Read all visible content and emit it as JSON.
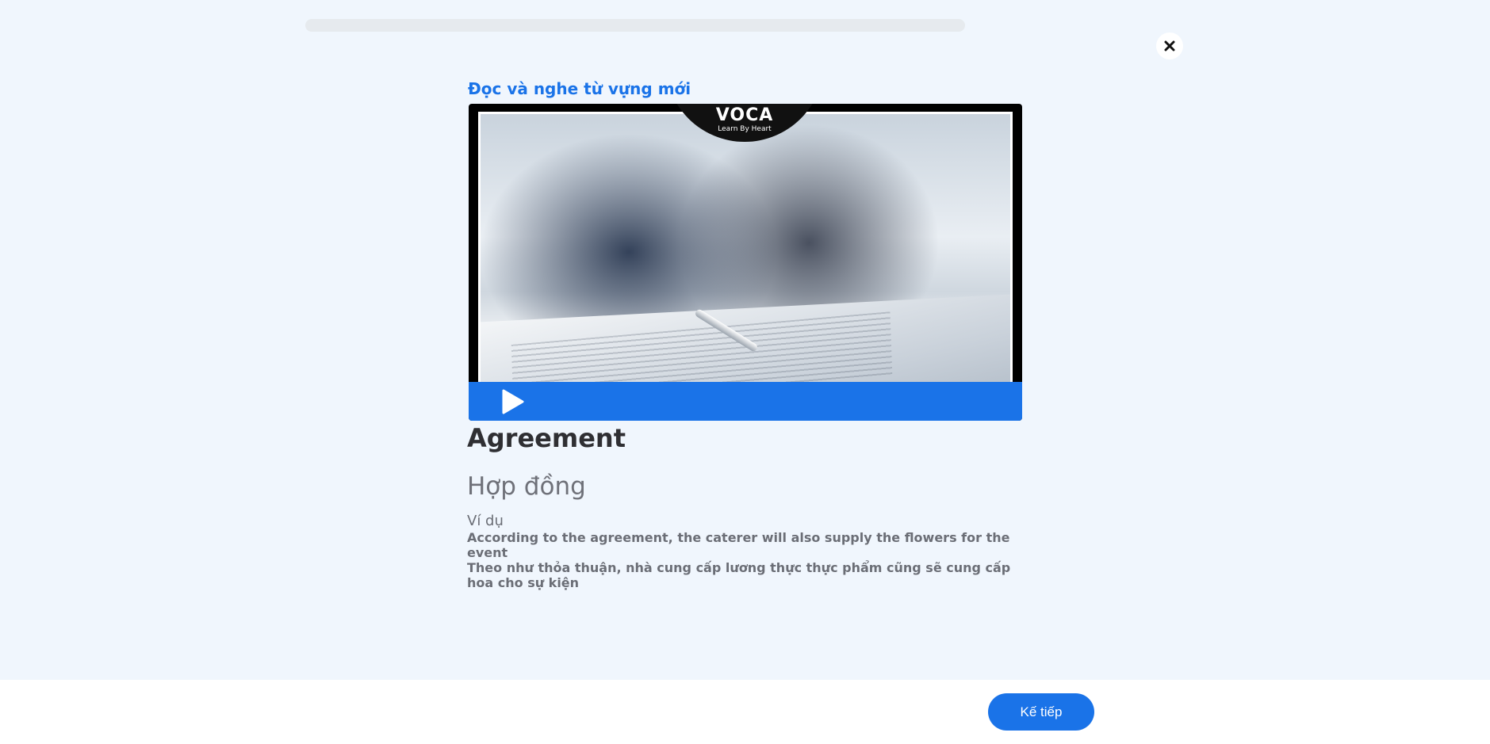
{
  "progress": {
    "value_percent": 0,
    "track_color": "#e6eaee",
    "fill_color": "#1a73e8"
  },
  "close_button": {
    "icon": "close-icon"
  },
  "lesson": {
    "section_title": "Đọc và nghe từ vựng mới",
    "media": {
      "logo_text": "VOCA",
      "logo_subtext": "Learn By Heart",
      "play_icon": "play-icon",
      "bar_color": "#1a73e8"
    },
    "word": "Agreement",
    "translation": "Hợp đồng",
    "example_label": "Ví dụ",
    "example_en": "According to the agreement, the caterer will also supply the flowers for the event",
    "example_vi": "Theo như thỏa thuận, nhà cung cấp lương thực thực phẩm cũng sẽ cung cấp hoa cho sự kiện"
  },
  "footer": {
    "next_label": "Kế tiếp"
  },
  "colors": {
    "accent": "#1a73e8",
    "background": "#f0f6fd",
    "word": "#2f2f33",
    "muted_text": "#6b6e76"
  }
}
